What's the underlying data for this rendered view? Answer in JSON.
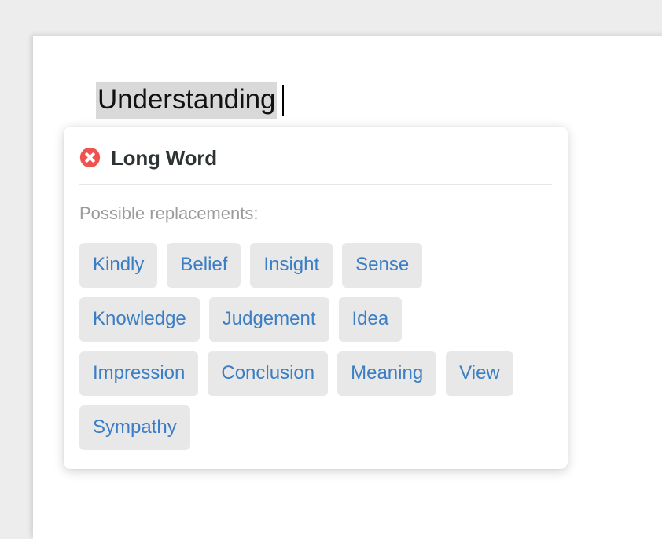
{
  "window": {
    "background_color": "#ededed",
    "page_color": "#ffffff"
  },
  "document": {
    "heading_text": "Understanding",
    "heading_highlight_color": "#d9d9d9",
    "caret_visible": true
  },
  "popup": {
    "icon": "error-circle-x-icon",
    "icon_color": "#ef5350",
    "title": "Long Word",
    "title_color": "#2e3436",
    "replacements_label": "Possible replacements:",
    "replacements_label_color": "#9b9b9b",
    "chip_background_color": "#e8e8e8",
    "chip_text_color": "#3b7ec4",
    "replacements": [
      "Kindly",
      "Belief",
      "Insight",
      "Sense",
      "Knowledge",
      "Judgement",
      "Idea",
      "Impression",
      "Conclusion",
      "Meaning",
      "View",
      "Sympathy"
    ]
  }
}
